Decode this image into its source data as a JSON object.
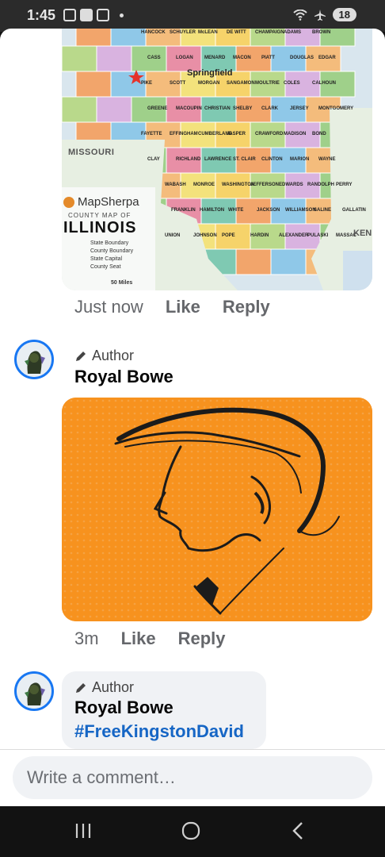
{
  "status": {
    "time": "1:45",
    "battery": "18"
  },
  "map": {
    "brand": "MapSherpa",
    "subtitle": "COUNTY MAP OF",
    "state": "ILLINOIS",
    "neighbor_left": "MISSOURI",
    "neighbor_right": "KEN",
    "capital": "Springfield",
    "legend": [
      "State Boundary",
      "County Boundary",
      "State Capital",
      "County Seat"
    ],
    "scale": "50 Miles",
    "county_labels": [
      "HANCOCK",
      "SCHUYLER",
      "McLEAN",
      "DE WITT",
      "CHAMPAIGN",
      "ADAMS",
      "BROWN",
      "CASS",
      "LOGAN",
      "MENARD",
      "MACON",
      "PIATT",
      "DOUGLAS",
      "EDGAR",
      "PIKE",
      "SCOTT",
      "MORGAN",
      "SANGAMON",
      "MOULTRIE",
      "COLES",
      "CALHOUN",
      "GREENE",
      "MACOUPIN",
      "CHRISTIAN",
      "SHELBY",
      "CLARK",
      "JERSEY",
      "MONTGOMERY",
      "FAYETTE",
      "EFFINGHAM",
      "CUMBERLAND",
      "JASPER",
      "CRAWFORD",
      "MADISON",
      "BOND",
      "CLAY",
      "RICHLAND",
      "LAWRENCE",
      "ST. CLAIR",
      "CLINTON",
      "MARION",
      "WAYNE",
      "WABASH",
      "MONROE",
      "WASHINGTON",
      "JEFFERSON",
      "EDWARDS",
      "RANDOLPH",
      "PERRY",
      "FRANKLIN",
      "HAMILTON",
      "WHITE",
      "JACKSON",
      "WILLIAMSON",
      "SALINE",
      "GALLATIN",
      "UNION",
      "JOHNSON",
      "POPE",
      "HARDIN",
      "ALEXANDER",
      "PULASKI",
      "MASSAC"
    ]
  },
  "comments": [
    {
      "time": "Just now",
      "like": "Like",
      "reply": "Reply"
    },
    {
      "badge": "Author",
      "name": "Royal Bowe",
      "time": "3m",
      "like": "Like",
      "reply": "Reply"
    },
    {
      "badge": "Author",
      "name": "Royal Bowe",
      "hashtag": "#FreeKingstonDavid"
    }
  ],
  "composer": {
    "placeholder": "Write a comment…"
  },
  "colors": {
    "accent": "#1877f2",
    "link": "#1666c5",
    "image_bg": "#f7921e"
  }
}
